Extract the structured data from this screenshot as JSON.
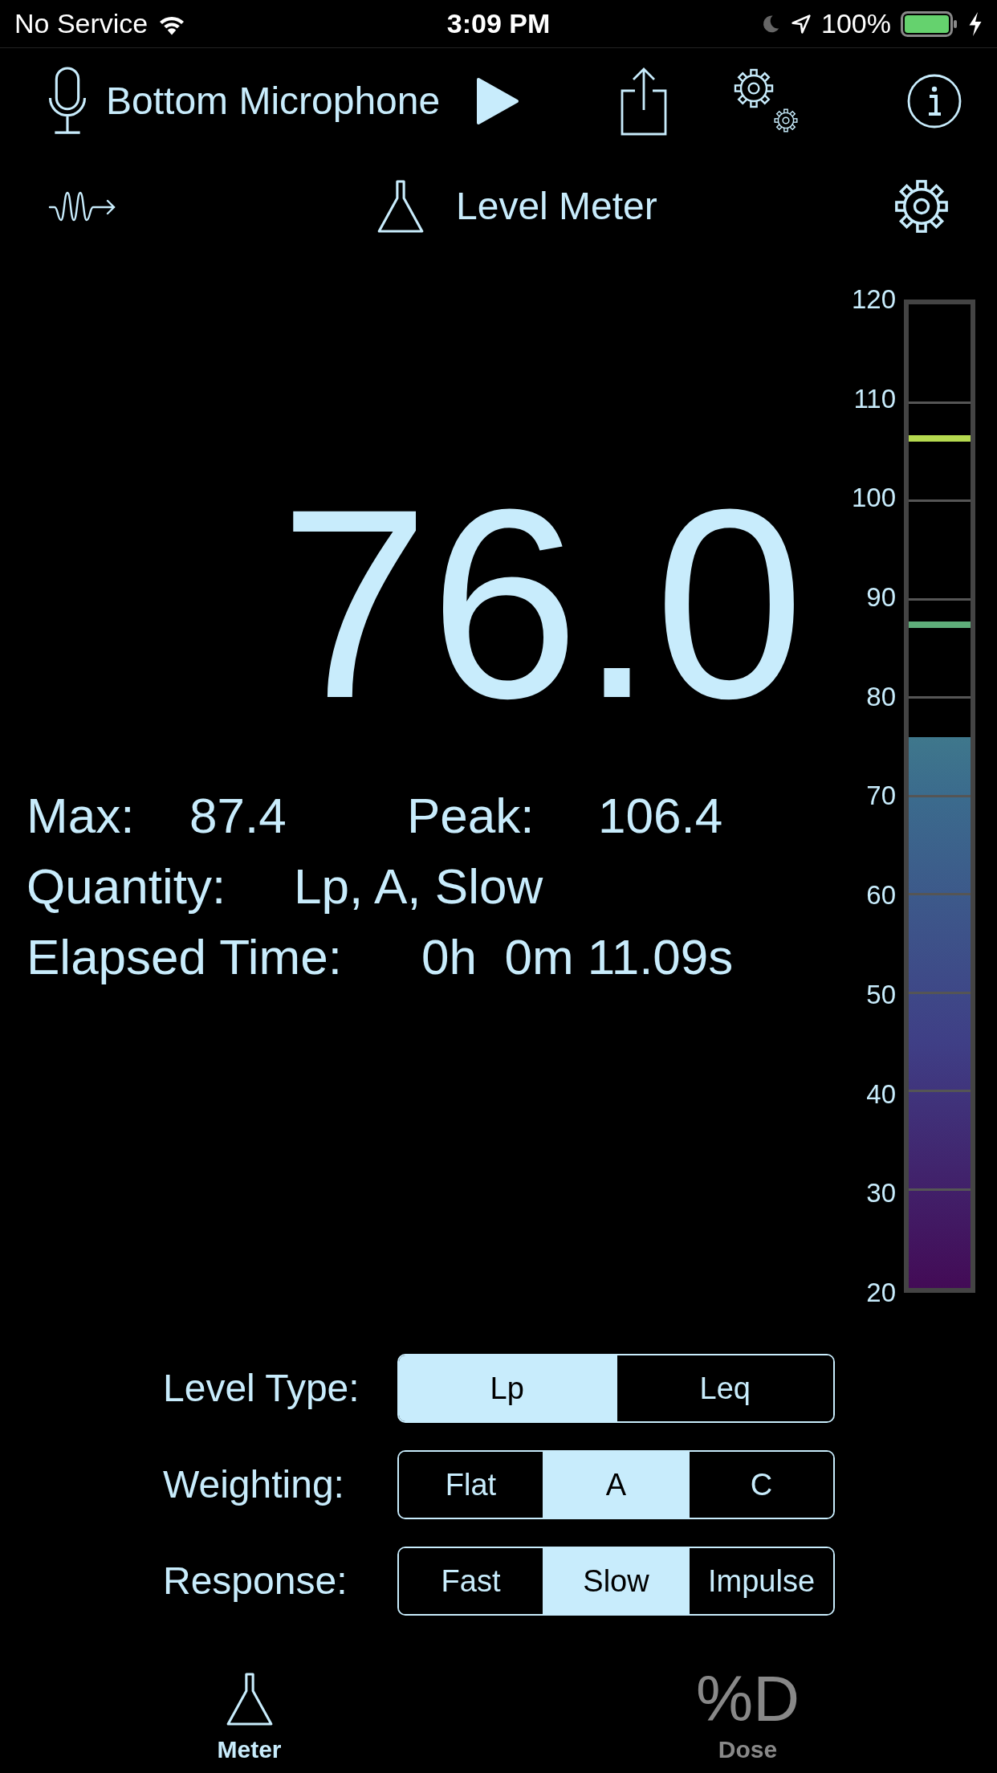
{
  "status_bar": {
    "carrier": "No Service",
    "time": "3:09 PM",
    "battery": "100%"
  },
  "toolbar": {
    "input": "Bottom Microphone"
  },
  "header": {
    "title": "Level Meter"
  },
  "reading": {
    "value": "76.0"
  },
  "stats": [
    {
      "label": "Max:",
      "value": "87.4"
    },
    {
      "label": "Peak:",
      "value": "106.4"
    }
  ],
  "quantity": {
    "label": "Quantity:",
    "value": "Lp, A, Slow"
  },
  "elapsed": {
    "label": "Elapsed Time:",
    "value": "0h  0m 11.09s"
  },
  "meter": {
    "ticks": [
      "120",
      "110",
      "100",
      "90",
      "80",
      "70",
      "60",
      "50",
      "40",
      "30",
      "20"
    ],
    "level": 0.56,
    "markers": [
      {
        "level": 0.864,
        "color": "#b5d94f"
      },
      {
        "level": 0.674,
        "color": "#5fae7a"
      }
    ]
  },
  "settings": [
    {
      "label": "Level Type:",
      "options": [
        {
          "label": "Lp",
          "selected": true
        },
        {
          "label": "Leq",
          "selected": false
        }
      ]
    },
    {
      "label": "Weighting:",
      "options": [
        {
          "label": "Flat",
          "selected": false
        },
        {
          "label": "A",
          "selected": true
        },
        {
          "label": "C",
          "selected": false
        }
      ]
    },
    {
      "label": "Response:",
      "options": [
        {
          "label": "Fast",
          "selected": false
        },
        {
          "label": "Slow",
          "selected": true
        },
        {
          "label": "Impulse",
          "selected": false
        }
      ]
    }
  ],
  "tabs": [
    {
      "label": "Meter",
      "kind": "flask",
      "selected": true
    },
    {
      "label": "Dose",
      "kind": "glyph",
      "glyph": "%D",
      "selected": false
    }
  ]
}
